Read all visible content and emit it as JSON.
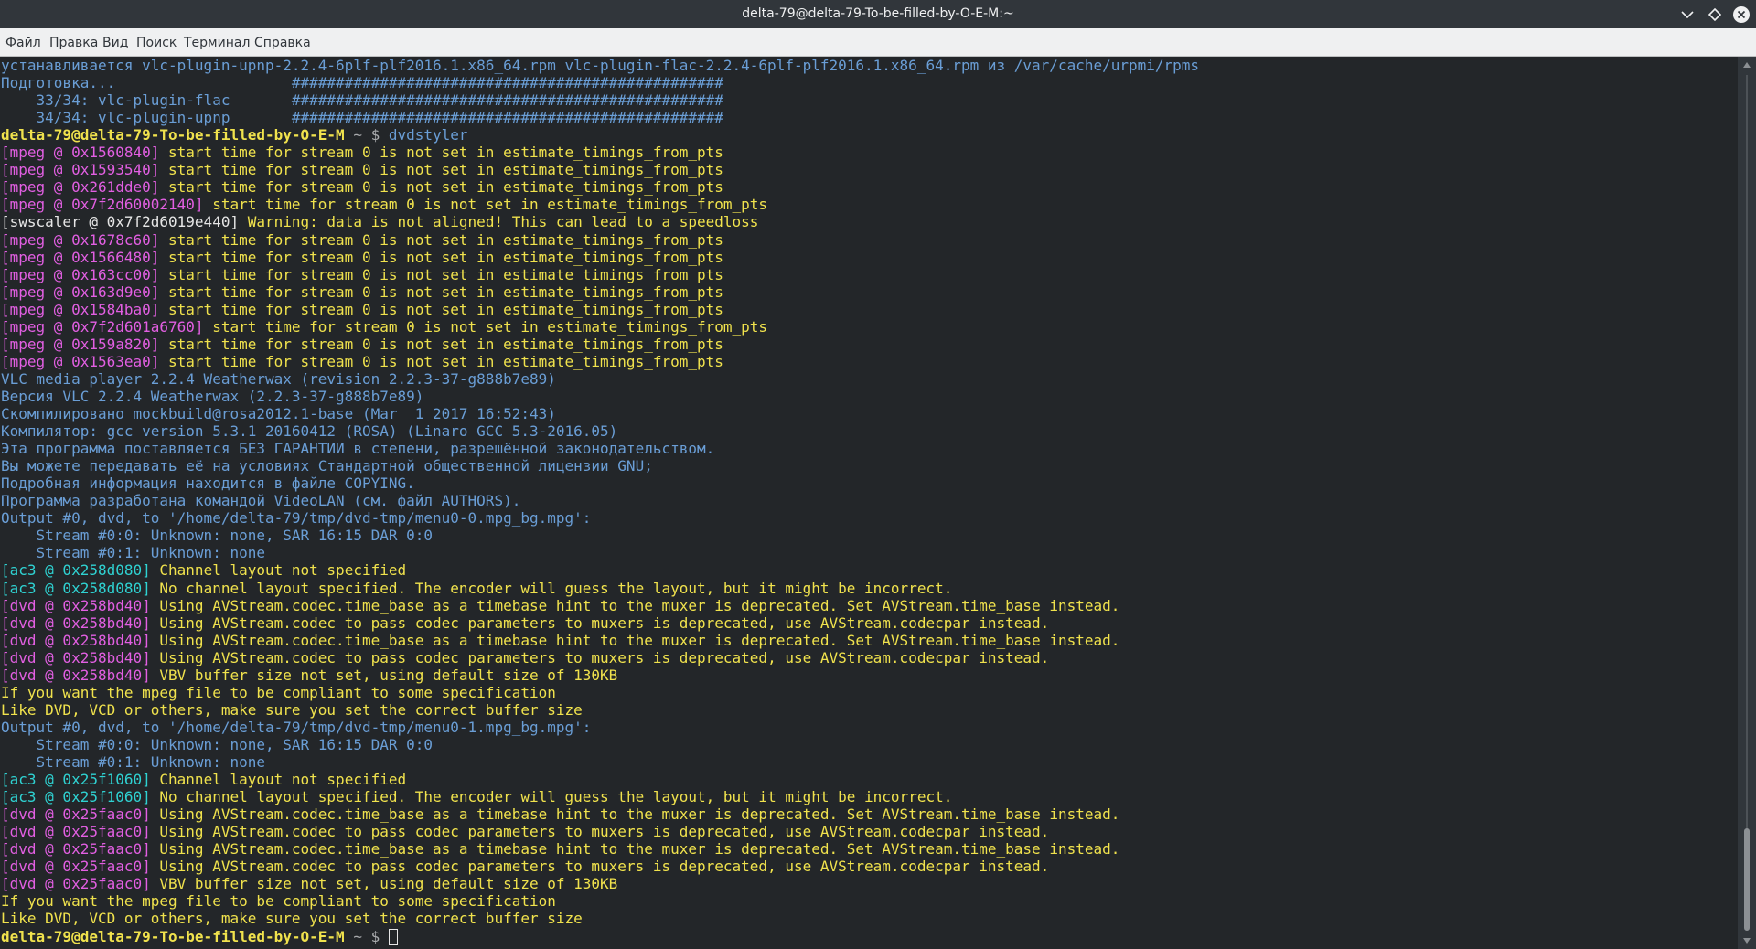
{
  "window": {
    "title": "delta-79@delta-79-To-be-filled-by-O-E-M:~"
  },
  "menu": [
    "Файл",
    "Правка",
    "Вид",
    "Поиск",
    "Терминал",
    "Справка"
  ],
  "icons": {
    "minimize": "chevron-down-icon",
    "maximize": "diamond-icon",
    "close": "close-icon"
  },
  "colors": {
    "background": "#232629",
    "blue": "#6a9ed6",
    "yellow": "#f0e24d",
    "magenta": "#e25fe2",
    "cyan": "#2fd2d2",
    "titlebar": "#31363b",
    "menubar": "#eff0f1"
  },
  "scrollbar": {
    "position_fraction": 1.0,
    "visible_fraction": 0.12
  },
  "terminal": {
    "lines": [
      [
        {
          "c": "blue",
          "t": "устанавливается vlc-plugin-upnp-2.2.4-6plf-plf2016.1.x86_64.rpm vlc-plugin-flac-2.2.4-6plf-plf2016.1.x86_64.rpm из /var/cache/urpmi/rpms"
        }
      ],
      [
        {
          "c": "blue",
          "t": "Подготовка...                    #################################################"
        }
      ],
      [
        {
          "c": "blue",
          "t": "    33/34: vlc-plugin-flac       #################################################"
        }
      ],
      [
        {
          "c": "blue",
          "t": "    34/34: vlc-plugin-upnp       #################################################"
        }
      ],
      [
        {
          "c": "prompt",
          "t": "delta-79@delta-79-To-be-filled-by-O-E-M"
        },
        {
          "c": "grey",
          "t": " ~ $ "
        },
        {
          "c": "blue",
          "t": "dvdstyler"
        }
      ],
      [
        {
          "c": "magenta",
          "t": "[mpeg @ 0x1560840]"
        },
        {
          "c": "yellow",
          "t": " start time for stream 0 is not set in estimate_timings_from_pts"
        }
      ],
      [
        {
          "c": "magenta",
          "t": "[mpeg @ 0x1593540]"
        },
        {
          "c": "yellow",
          "t": " start time for stream 0 is not set in estimate_timings_from_pts"
        }
      ],
      [
        {
          "c": "magenta",
          "t": "[mpeg @ 0x261dde0]"
        },
        {
          "c": "yellow",
          "t": " start time for stream 0 is not set in estimate_timings_from_pts"
        }
      ],
      [
        {
          "c": "magenta",
          "t": "[mpeg @ 0x7f2d60002140]"
        },
        {
          "c": "yellow",
          "t": " start time for stream 0 is not set in estimate_timings_from_pts"
        }
      ],
      [
        {
          "c": "white",
          "t": "[swscaler @ 0x7f2d6019e440]"
        },
        {
          "c": "yellow",
          "t": " Warning: data is not aligned! This can lead to a speedloss"
        }
      ],
      [
        {
          "c": "magenta",
          "t": "[mpeg @ 0x1678c60]"
        },
        {
          "c": "yellow",
          "t": " start time for stream 0 is not set in estimate_timings_from_pts"
        }
      ],
      [
        {
          "c": "magenta",
          "t": "[mpeg @ 0x1566480]"
        },
        {
          "c": "yellow",
          "t": " start time for stream 0 is not set in estimate_timings_from_pts"
        }
      ],
      [
        {
          "c": "magenta",
          "t": "[mpeg @ 0x163cc00]"
        },
        {
          "c": "yellow",
          "t": " start time for stream 0 is not set in estimate_timings_from_pts"
        }
      ],
      [
        {
          "c": "magenta",
          "t": "[mpeg @ 0x163d9e0]"
        },
        {
          "c": "yellow",
          "t": " start time for stream 0 is not set in estimate_timings_from_pts"
        }
      ],
      [
        {
          "c": "magenta",
          "t": "[mpeg @ 0x1584ba0]"
        },
        {
          "c": "yellow",
          "t": " start time for stream 0 is not set in estimate_timings_from_pts"
        }
      ],
      [
        {
          "c": "magenta",
          "t": "[mpeg @ 0x7f2d601a6760]"
        },
        {
          "c": "yellow",
          "t": " start time for stream 0 is not set in estimate_timings_from_pts"
        }
      ],
      [
        {
          "c": "magenta",
          "t": "[mpeg @ 0x159a820]"
        },
        {
          "c": "yellow",
          "t": " start time for stream 0 is not set in estimate_timings_from_pts"
        }
      ],
      [
        {
          "c": "magenta",
          "t": "[mpeg @ 0x1563ea0]"
        },
        {
          "c": "yellow",
          "t": " start time for stream 0 is not set in estimate_timings_from_pts"
        }
      ],
      [
        {
          "c": "blue",
          "t": "VLC media player 2.2.4 Weatherwax (revision 2.2.3-37-g888b7e89)"
        }
      ],
      [
        {
          "c": "blue",
          "t": "Версия VLC 2.2.4 Weatherwax (2.2.3-37-g888b7e89)"
        }
      ],
      [
        {
          "c": "blue",
          "t": "Скомпилировано mockbuild@rosa2012.1-base (Mar  1 2017 16:52:43)"
        }
      ],
      [
        {
          "c": "blue",
          "t": "Компилятор: gcc version 5.3.1 20160412 (ROSA) (Linaro GCC 5.3-2016.05)"
        }
      ],
      [
        {
          "c": "blue",
          "t": "Эта программа поставляется БЕЗ ГАРАНТИИ в степени, разрешённой законодательством."
        }
      ],
      [
        {
          "c": "blue",
          "t": "Вы можете передавать её на условиях Стандартной общественной лицензии GNU;"
        }
      ],
      [
        {
          "c": "blue",
          "t": "Подробная информация находится в файле COPYING."
        }
      ],
      [
        {
          "c": "blue",
          "t": "Программа разработана командой VideoLAN (см. файл AUTHORS)."
        }
      ],
      [
        {
          "c": "blue",
          "t": "Output #0, dvd, to '/home/delta-79/tmp/dvd-tmp/menu0-0.mpg_bg.mpg':"
        }
      ],
      [
        {
          "c": "blue",
          "t": "    Stream #0:0: Unknown: none, SAR 16:15 DAR 0:0"
        }
      ],
      [
        {
          "c": "blue",
          "t": "    Stream #0:1: Unknown: none"
        }
      ],
      [
        {
          "c": "cyan",
          "t": "[ac3 @ 0x258d080]"
        },
        {
          "c": "yellow",
          "t": " Channel layout not specified"
        }
      ],
      [
        {
          "c": "cyan",
          "t": "[ac3 @ 0x258d080]"
        },
        {
          "c": "yellow",
          "t": " No channel layout specified. The encoder will guess the layout, but it might be incorrect."
        }
      ],
      [
        {
          "c": "magenta",
          "t": "[dvd @ 0x258bd40]"
        },
        {
          "c": "yellow",
          "t": " Using AVStream.codec.time_base as a timebase hint to the muxer is deprecated. Set AVStream.time_base instead."
        }
      ],
      [
        {
          "c": "magenta",
          "t": "[dvd @ 0x258bd40]"
        },
        {
          "c": "yellow",
          "t": " Using AVStream.codec to pass codec parameters to muxers is deprecated, use AVStream.codecpar instead."
        }
      ],
      [
        {
          "c": "magenta",
          "t": "[dvd @ 0x258bd40]"
        },
        {
          "c": "yellow",
          "t": " Using AVStream.codec.time_base as a timebase hint to the muxer is deprecated. Set AVStream.time_base instead."
        }
      ],
      [
        {
          "c": "magenta",
          "t": "[dvd @ 0x258bd40]"
        },
        {
          "c": "yellow",
          "t": " Using AVStream.codec to pass codec parameters to muxers is deprecated, use AVStream.codecpar instead."
        }
      ],
      [
        {
          "c": "magenta",
          "t": "[dvd @ 0x258bd40]"
        },
        {
          "c": "yellow",
          "t": " VBV buffer size not set, using default size of 130KB"
        }
      ],
      [
        {
          "c": "yellow",
          "t": "If you want the mpeg file to be compliant to some specification"
        }
      ],
      [
        {
          "c": "yellow",
          "t": "Like DVD, VCD or others, make sure you set the correct buffer size"
        }
      ],
      [
        {
          "c": "blue",
          "t": "Output #0, dvd, to '/home/delta-79/tmp/dvd-tmp/menu0-1.mpg_bg.mpg':"
        }
      ],
      [
        {
          "c": "blue",
          "t": "    Stream #0:0: Unknown: none, SAR 16:15 DAR 0:0"
        }
      ],
      [
        {
          "c": "blue",
          "t": "    Stream #0:1: Unknown: none"
        }
      ],
      [
        {
          "c": "cyan",
          "t": "[ac3 @ 0x25f1060]"
        },
        {
          "c": "yellow",
          "t": " Channel layout not specified"
        }
      ],
      [
        {
          "c": "cyan",
          "t": "[ac3 @ 0x25f1060]"
        },
        {
          "c": "yellow",
          "t": " No channel layout specified. The encoder will guess the layout, but it might be incorrect."
        }
      ],
      [
        {
          "c": "magenta",
          "t": "[dvd @ 0x25faac0]"
        },
        {
          "c": "yellow",
          "t": " Using AVStream.codec.time_base as a timebase hint to the muxer is deprecated. Set AVStream.time_base instead."
        }
      ],
      [
        {
          "c": "magenta",
          "t": "[dvd @ 0x25faac0]"
        },
        {
          "c": "yellow",
          "t": " Using AVStream.codec to pass codec parameters to muxers is deprecated, use AVStream.codecpar instead."
        }
      ],
      [
        {
          "c": "magenta",
          "t": "[dvd @ 0x25faac0]"
        },
        {
          "c": "yellow",
          "t": " Using AVStream.codec.time_base as a timebase hint to the muxer is deprecated. Set AVStream.time_base instead."
        }
      ],
      [
        {
          "c": "magenta",
          "t": "[dvd @ 0x25faac0]"
        },
        {
          "c": "yellow",
          "t": " Using AVStream.codec to pass codec parameters to muxers is deprecated, use AVStream.codecpar instead."
        }
      ],
      [
        {
          "c": "magenta",
          "t": "[dvd @ 0x25faac0]"
        },
        {
          "c": "yellow",
          "t": " VBV buffer size not set, using default size of 130KB"
        }
      ],
      [
        {
          "c": "yellow",
          "t": "If you want the mpeg file to be compliant to some specification"
        }
      ],
      [
        {
          "c": "yellow",
          "t": "Like DVD, VCD or others, make sure you set the correct buffer size"
        }
      ],
      [
        {
          "c": "prompt",
          "t": "delta-79@delta-79-To-be-filled-by-O-E-M"
        },
        {
          "c": "grey",
          "t": " ~ $ "
        }
      ]
    ]
  }
}
